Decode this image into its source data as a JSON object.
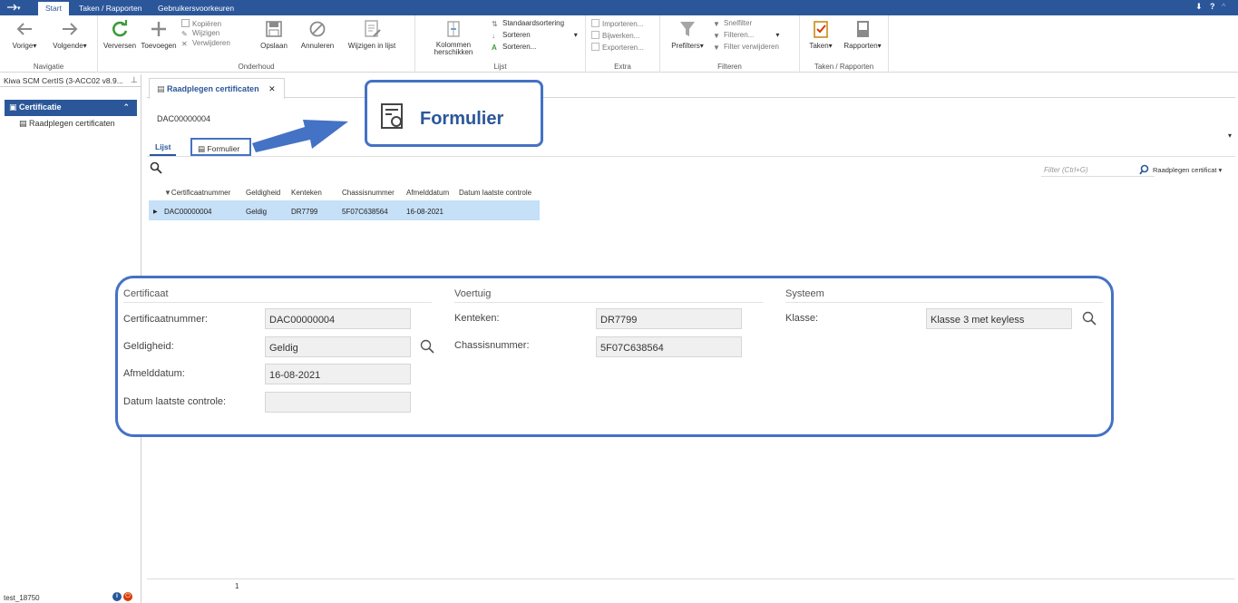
{
  "titlebar": {
    "qat_label": "▾",
    "tabs": [
      "Start",
      "Taken / Rapporten",
      "Gebruikersvoorkeuren"
    ],
    "controls": "?"
  },
  "ribbon": {
    "navigatie": {
      "label": "Navigatie",
      "prev": "Vorige",
      "next": "Volgende"
    },
    "onderhoud": {
      "label": "Onderhoud",
      "refresh": "Verversen",
      "add": "Toevoegen",
      "copy": "Kopiëren",
      "edit": "Wijzigen",
      "delete": "Verwijderen",
      "save": "Opslaan",
      "cancel": "Annuleren",
      "list_edit": "Wijzigen in lijst"
    },
    "lijst": {
      "label": "Lijst",
      "reorder_1": "Kolommen",
      "reorder_2": "herschikken",
      "default_sort": "Standaardsortering",
      "sort": "Sorteren",
      "sort_more": "Sorteren..."
    },
    "extra": {
      "label": "Extra",
      "import": "Importeren...",
      "update": "Bijwerken...",
      "export": "Exporteren..."
    },
    "filteren": {
      "label": "Filteren",
      "prefilters": "Prefilters",
      "quickfilter": "Snelfilter",
      "filter": "Filteren...",
      "remove_filter": "Filter verwijderen"
    },
    "taken": {
      "label": "Taken / Rapporten",
      "tasks": "Taken",
      "reports": "Rapporten"
    }
  },
  "nav": {
    "header": "Kiwa SCM CertIS (3-ACC02 v8.9...",
    "section": "Certificatie",
    "item": "Raadplegen certificaten"
  },
  "status": {
    "user": "test_18750"
  },
  "document": {
    "tab_title": "Raadplegen certificaten",
    "record_id": "DAC00000004",
    "view_tabs": {
      "list": "Lijst",
      "form": "Formulier"
    },
    "filter_placeholder": "Filter (Ctrl+G)",
    "view_select": "Raadplegen certificat",
    "page": "1"
  },
  "grid": {
    "columns": [
      "Certificaatnummer",
      "Geldigheid",
      "Kenteken",
      "Chassisnummer",
      "Afmelddatum",
      "Datum laatste controle"
    ],
    "rows": [
      [
        "DAC00000004",
        "Geldig",
        "DR7799",
        "5F07C638564",
        "16-08-2021",
        ""
      ]
    ]
  },
  "form": {
    "certificaat": {
      "title": "Certificaat",
      "fields": [
        {
          "label": "Certificaatnummer:",
          "value": "DAC00000004"
        },
        {
          "label": "Geldigheid:",
          "value": "Geldig"
        },
        {
          "label": "Afmelddatum:",
          "value": "16-08-2021"
        },
        {
          "label": "Datum laatste controle:",
          "value": ""
        }
      ]
    },
    "voertuig": {
      "title": "Voertuig",
      "fields": [
        {
          "label": "Kenteken:",
          "value": "DR7799"
        },
        {
          "label": "Chassisnummer:",
          "value": "5F07C638564"
        }
      ]
    },
    "systeem": {
      "title": "Systeem",
      "fields": [
        {
          "label": "Klasse:",
          "value": "Klasse 3 met keyless"
        }
      ]
    }
  },
  "callout": {
    "label": "Formulier"
  },
  "colors": {
    "accent": "#2b579a",
    "highlight": "#4472c4",
    "row_selected": "#c6e0f7",
    "green": "#3c9b3c",
    "red": "#d83b01"
  }
}
